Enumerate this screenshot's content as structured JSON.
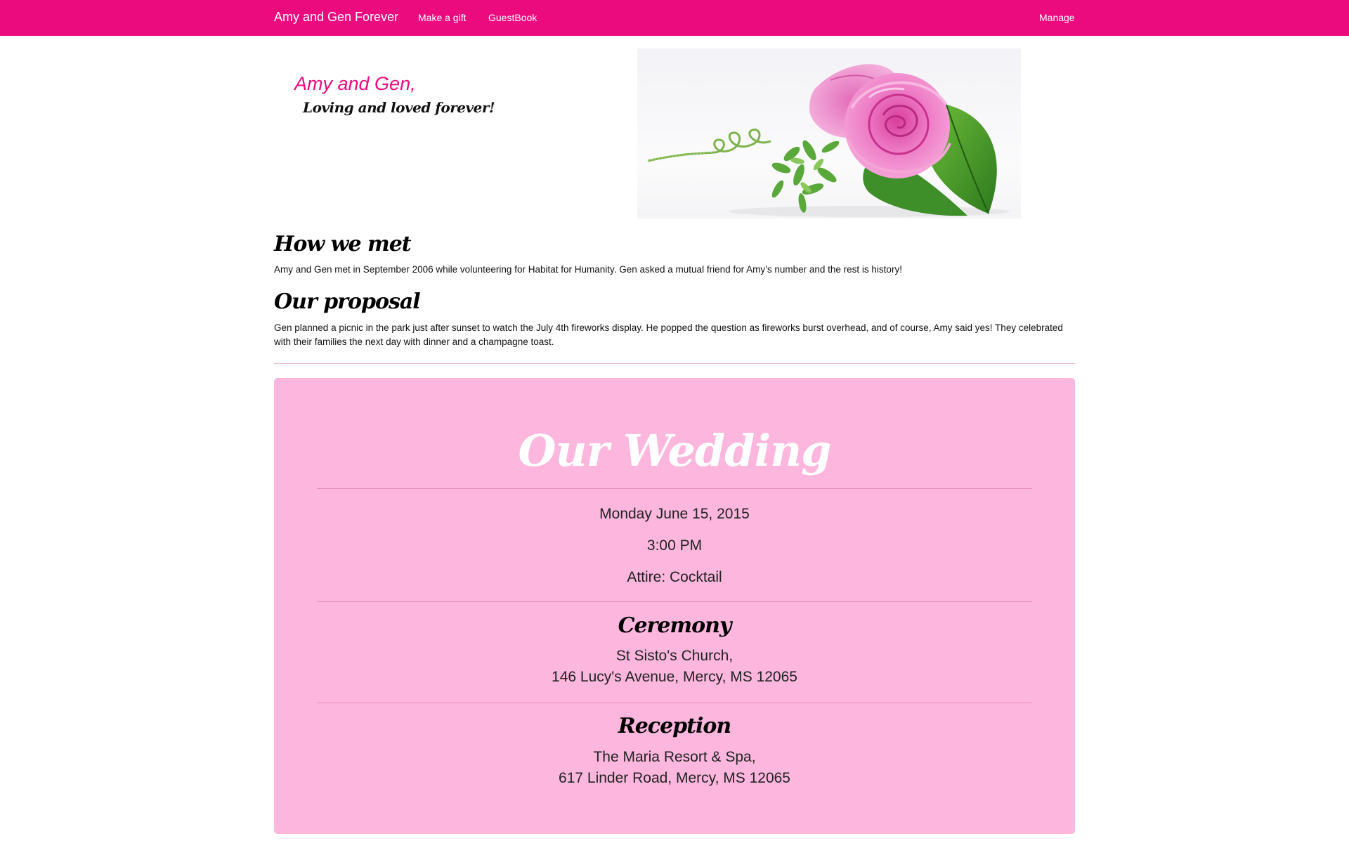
{
  "nav": {
    "brand": "Amy and Gen Forever",
    "links": [
      "Make a gift",
      "GuestBook"
    ],
    "manage": "Manage"
  },
  "hero": {
    "title": "Amy and Gen,",
    "subtitle": "Loving and loved forever!",
    "image": "pink-rose-photo"
  },
  "how_we_met": {
    "heading": "How we met",
    "text": "Amy and Gen met in September 2006 while volunteering for Habitat for Humanity. Gen asked a mutual friend for Amy’s number and the rest is history!"
  },
  "proposal": {
    "heading": "Our proposal",
    "text": "Gen planned a picnic in the park just after sunset to watch the July 4th fireworks display. He popped the question as fireworks burst overhead, and of course, Amy said yes! They celebrated with their families the next day with dinner and a champagne toast."
  },
  "wedding": {
    "title": "Our Wedding",
    "date": "Monday June 15, 2015",
    "time": "3:00 PM",
    "attire": "Attire: Cocktail",
    "ceremony": {
      "heading": "Ceremony",
      "venue": "St Sisto's Church,",
      "address": "146 Lucy's Avenue, Mercy, MS 12065"
    },
    "reception": {
      "heading": "Reception",
      "venue": "The Maria Resort & Spa,",
      "address": "617 Linder Road, Mercy, MS 12065"
    }
  },
  "colors": {
    "brand_pink": "#ec0a7f",
    "panel_pink": "#fdb6de",
    "white": "#ffffff"
  }
}
